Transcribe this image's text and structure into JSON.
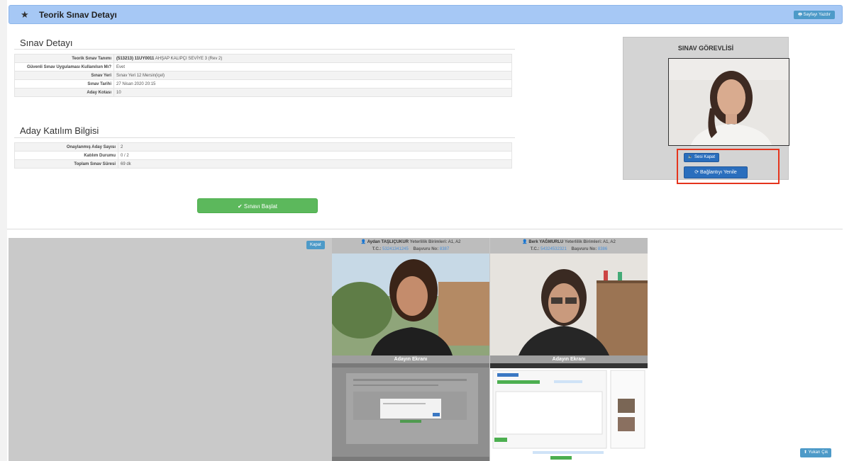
{
  "header": {
    "title": "Teorik Sınav Detayı",
    "print_button": "Sayfayı Yazdır"
  },
  "exam_detail": {
    "title": "Sınav Detayı",
    "rows": [
      {
        "label": "Teorik Sınav Tanımı",
        "value_bold": "(513213) 11UY0011",
        "value": "AHŞAP KALIPÇI SEVİYE 3 (Rev 2)"
      },
      {
        "label": "Güvenli Sınav Uygulaması Kullanılsın Mı?",
        "value": "Evet"
      },
      {
        "label": "Sınav Yeri",
        "value": "Sınav Yeri 12 Mersin(içel)"
      },
      {
        "label": "Sınav Tarihi",
        "value": "27 Nisan 2020 20:15"
      },
      {
        "label": "Aday Kotası",
        "value": "10"
      }
    ]
  },
  "participation": {
    "title": "Aday Katılım Bilgisi",
    "rows": [
      {
        "label": "Onaylanmış Aday Sayısı",
        "value": "2"
      },
      {
        "label": "Katılım Durumu",
        "value": "0 / 2"
      },
      {
        "label": "Toplam Sınav Süresi",
        "value": "69 dk"
      }
    ]
  },
  "start_button": "Sınavı Başlat",
  "proctor": {
    "title": "SINAV GÖREVLİSİ",
    "mute_button": "Sesi Kapat",
    "refresh_button": "Bağlantıyı Yenile"
  },
  "cameras": {
    "close_button": "Kapat",
    "candidates": [
      {
        "name": "Aydan TAŞLIÇUKUR",
        "units_label": "Yeterlilik Birimleri:",
        "units": "A1, A2",
        "tc_label": "T.C.:",
        "tc": "53241341245",
        "app_label": "Başvuru No:",
        "app_no": "8387",
        "screen_label": "Adayın Ekranı"
      },
      {
        "name": "Berk YAĞMURLU",
        "units_label": "Yeterlilik Birimleri:",
        "units": "A1, A2",
        "tc_label": "T.C.:",
        "tc": "54324532321",
        "app_label": "Başvuru No:",
        "app_no": "8386",
        "screen_label": "Adayın Ekranı"
      }
    ]
  },
  "scroll_top_button": "Yukarı Çık",
  "colors": {
    "header_bg": "#a6c8f5",
    "primary_blue": "#2a6ebd",
    "success_green": "#5cb85c",
    "highlight_red": "#e5341d"
  }
}
